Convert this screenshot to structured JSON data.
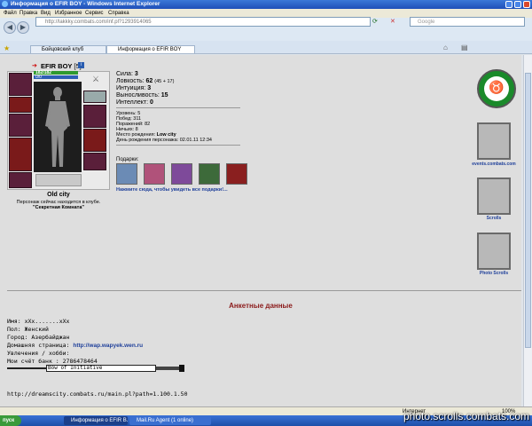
{
  "window": {
    "title": "Информация о EFIR BOY - Windows Internet Explorer"
  },
  "menu": [
    "Файл",
    "Правка",
    "Вид",
    "Избранное",
    "Сервис",
    "Справка"
  ],
  "address": {
    "url": "http://lakkky.combats.com/inf.pl?1293914065"
  },
  "search": {
    "placeholder": "Google"
  },
  "tabs": [
    {
      "label": "Бойцовский клуб"
    },
    {
      "label": "Информация о EFIR BOY"
    }
  ],
  "character": {
    "name": "EFIR BOY",
    "level": "[5]",
    "hp_text": "182/182",
    "mana_text": "0/0",
    "city": "Old city",
    "location_text": "Персонаж сейчас находится в клубе.",
    "room": "\"Секретная Комната\""
  },
  "stats": [
    {
      "label": "Сила:",
      "value": "3",
      "extra": ""
    },
    {
      "label": "Ловкость:",
      "value": "62",
      "extra": "(45 + 17)"
    },
    {
      "label": "Интуиция:",
      "value": "3",
      "extra": ""
    },
    {
      "label": "Выносливость:",
      "value": "15",
      "extra": ""
    },
    {
      "label": "Интеллект:",
      "value": "0",
      "extra": ""
    }
  ],
  "info": {
    "level": "Уровень: 5",
    "wins": "Побед: 311",
    "losses": "Поражений: 82",
    "draws": "Ничьих: 8",
    "birthplace_label": "Место рождения:",
    "birthplace": "Low city",
    "birthday": "День рождения персонажа: 02.01.11 12:34"
  },
  "gifts": {
    "title": "Подарки:",
    "link": "Нажмите сюда, чтобы увидеть все подарки!..."
  },
  "side": [
    {
      "label": "events.combats.com"
    },
    {
      "label": "Scrolls"
    },
    {
      "label": "Photo Scrolls"
    }
  ],
  "profile": {
    "heading": "Анкетные данные",
    "name": "Имя: xXx.......xXx",
    "gender": "Пол: Женский",
    "city": "Город: Азербайджан",
    "homepage_label": "Домашняя страница:",
    "homepage": "http://wap.wapyek.wen.ru",
    "hobbies": "Увлечения / хобби:",
    "bank": "Мои счёт банк : 2786478464",
    "banner_text": "Bow of Initiative",
    "link": "http://dreamscity.combats.ru/main.pl?path=1.100.1.50"
  },
  "statusbar": {
    "zone": "Интернет",
    "zoom": "100%"
  },
  "taskbar": {
    "start": "пуск",
    "tasks": [
      "Информация о EFIR B...",
      "Mail.Ru Agent (1 online)"
    ]
  },
  "watermark": "photo.scrolls.combats.com",
  "colors": {
    "accent": "#1f4fb8",
    "link": "#1e3f9a",
    "heading": "#8b1a1a",
    "emblem": "#1a8a2a"
  }
}
